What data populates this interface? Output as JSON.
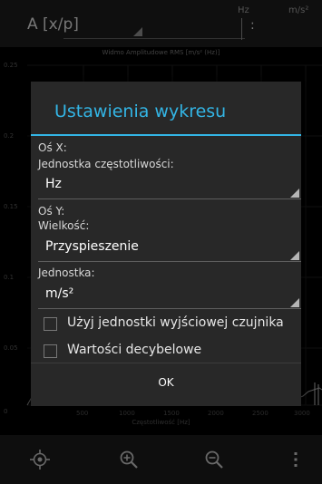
{
  "toolbar": {
    "left_label": "A [x/p]",
    "x_unit_label": "Hz",
    "y_unit_label": "m/s²",
    "colon": ":"
  },
  "chart": {
    "title": "Widmo Amplitudowe RMS [m/s² (Hz)]",
    "y_ticks": [
      "0.25",
      "0.2",
      "0.15",
      "0.1",
      "0.05",
      "0"
    ],
    "x_ticks": [
      "500",
      "1000",
      "1500",
      "2000",
      "2500",
      "3000"
    ],
    "xlabel": "Częstotliwość [Hz]"
  },
  "dialog": {
    "title": "Ustawienia wykresu",
    "x_axis_label": "Oś X:",
    "freq_unit_label": "Jednostka częstotliwości:",
    "freq_unit_value": "Hz",
    "y_axis_label": "Oś Y:",
    "quantity_label": "Wielkość:",
    "quantity_value": "Przyspieszenie",
    "unit_label": "Jednostka:",
    "unit_value": "m/s²",
    "checkbox_sensor_unit": "Użyj jednostki wyjściowej czujnika",
    "checkbox_sensor_unit_checked": false,
    "checkbox_decibel": "Wartości decybelowe",
    "checkbox_decibel_checked": false,
    "ok_label": "OK"
  },
  "bottom_bar": {
    "icons": [
      "crosshair-icon",
      "zoom-in-icon",
      "zoom-out-icon",
      "overflow-menu-icon"
    ]
  },
  "colors": {
    "accent": "#33b5e5",
    "dialog_bg": "#282828"
  }
}
